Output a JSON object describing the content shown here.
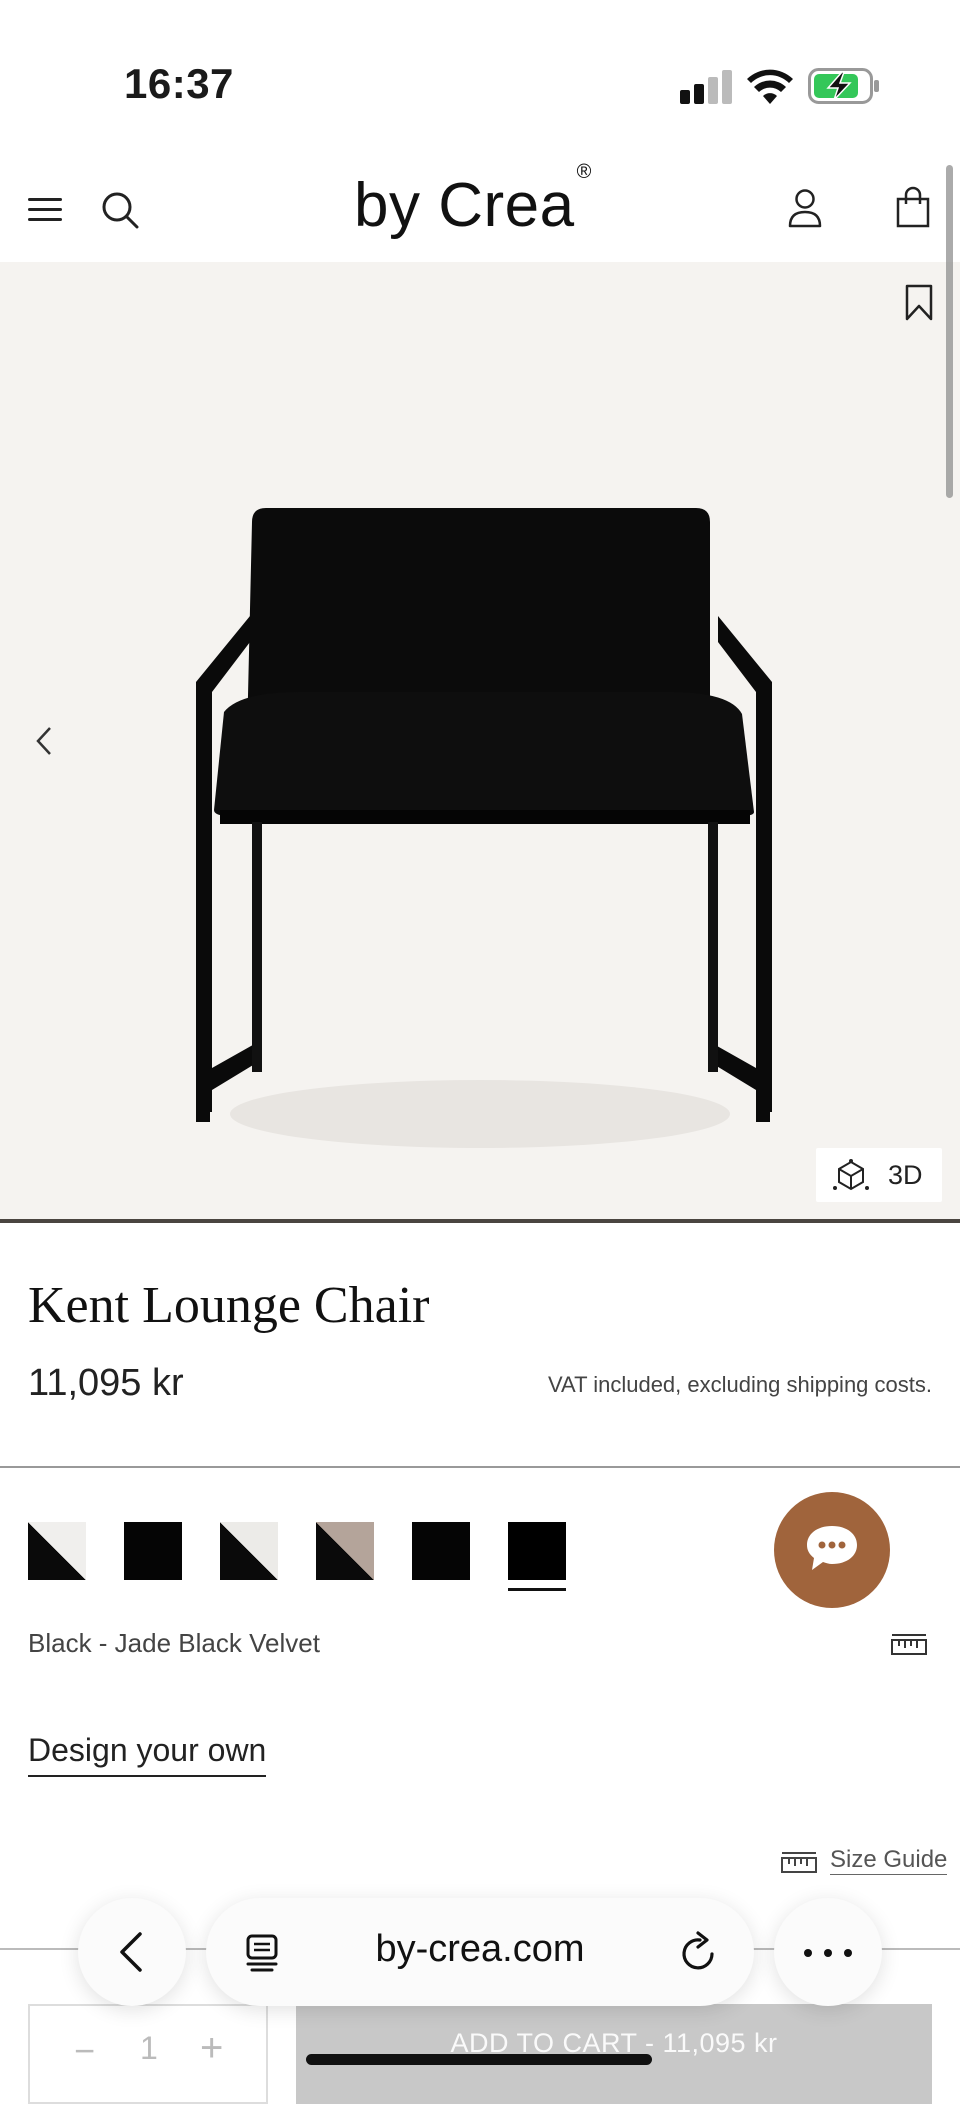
{
  "status_bar": {
    "time": "16:37"
  },
  "header": {
    "logo": "by Crea",
    "logo_mark": "®"
  },
  "hero": {
    "view_3d_label": "3D"
  },
  "product": {
    "title": "Kent Lounge Chair",
    "price": "11,095 kr",
    "vat_note": "VAT included, excluding shipping costs.",
    "variant_label": "Black - Jade Black Velvet",
    "swatches": [
      {
        "color_a": "#0a0a0a",
        "color_b": "#f0efed"
      },
      {
        "color_a": "#050505",
        "color_b": "#050505"
      },
      {
        "color_a": "#0a0a0a",
        "color_b": "#ecebe8"
      },
      {
        "color_a": "#0a0a0a",
        "color_b": "#b4a49a"
      },
      {
        "color_a": "#050505",
        "color_b": "#050505"
      },
      {
        "color_a": "#000000",
        "color_b": "#000000"
      }
    ],
    "selected_swatch": 6,
    "design_link": "Design your own",
    "size_guide": "Size Guide"
  },
  "cart": {
    "qty_minus": "−",
    "quantity": "1",
    "qty_plus": "+",
    "add_to_cart": "ADD TO CART - 11,095 kr"
  },
  "browser": {
    "url": "by-crea.com"
  },
  "colors": {
    "chat_accent": "#a0643c",
    "hero_bg": "#f5f3f0"
  }
}
